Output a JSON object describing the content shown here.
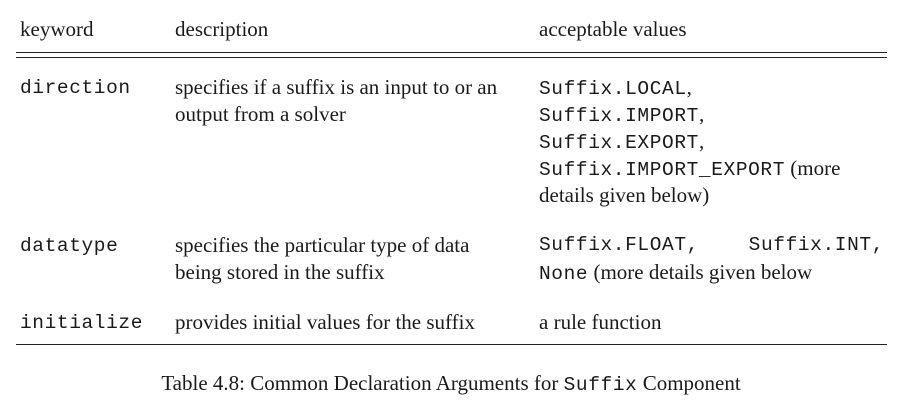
{
  "table": {
    "headers": {
      "keyword": "keyword",
      "description": "description",
      "values": "acceptable values"
    },
    "rows": [
      {
        "keyword": "direction",
        "description_lines": [
          "specifies if a suffix is an input to or an",
          "output from a solver"
        ],
        "values_lines": [
          {
            "mono": "Suffix.LOCAL",
            "text": ","
          },
          {
            "mono": "Suffix.IMPORT",
            "text": ","
          },
          {
            "mono": "Suffix.EXPORT",
            "text": ","
          },
          {
            "mono": "Suffix.IMPORT_EXPORT",
            "text": " (more"
          },
          {
            "mono": "",
            "text": "details given below)"
          }
        ]
      },
      {
        "keyword": "datatype",
        "description_lines": [
          "specifies the particular type of data",
          "being stored in the suffix"
        ],
        "values_line1": {
          "a": "Suffix.FLOAT,",
          "b": "Suffix.INT,"
        },
        "values_line2": {
          "mono": "None",
          "text": " (more details given below"
        }
      },
      {
        "keyword": "initialize",
        "description_lines": [
          "provides initial values for the suffix"
        ],
        "values_text": "a rule function"
      }
    ]
  },
  "caption": {
    "prefix": "Table 4.8: Common Declaration Arguments for ",
    "mono": "Suffix",
    "suffix": " Component"
  }
}
